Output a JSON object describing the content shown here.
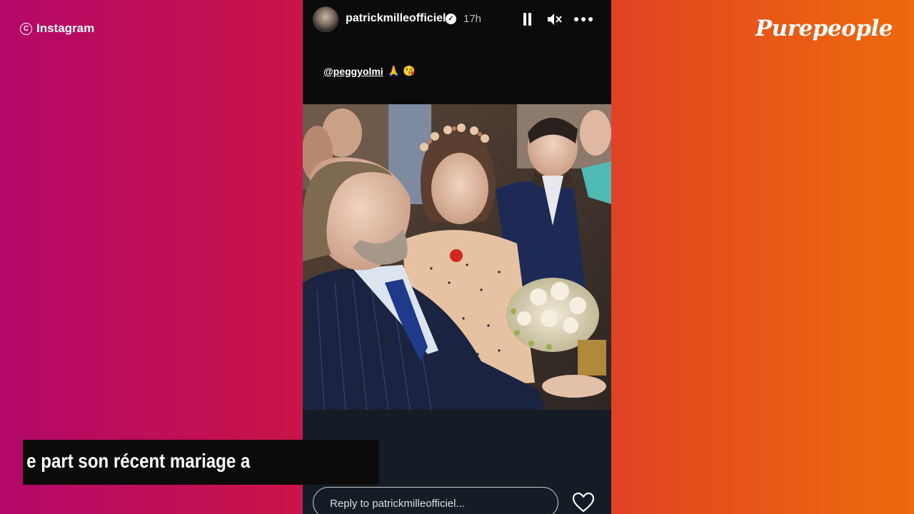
{
  "overlay": {
    "credit_text": "Instagram",
    "credit_icon": "copyright-icon",
    "brand": "Purepeople",
    "caption": "e part son récent mariage a"
  },
  "story": {
    "username": "patrickmilleofficiel",
    "verified_icon": "verified-badge-icon",
    "time": "17h",
    "controls": [
      "pause-icon",
      "mute-icon",
      "more-icon"
    ],
    "mention_handle": "@peggyolmi",
    "mention_emojis": "🙏 😘",
    "reply_placeholder": "Reply to patrickmilleofficiel...",
    "like_icon": "heart-icon"
  },
  "colors": {
    "gradient_left": "#b3086a",
    "gradient_right": "#ee6a0c",
    "story_bg": "#0b0b0b",
    "story_bottom_bg": "#141c26"
  }
}
